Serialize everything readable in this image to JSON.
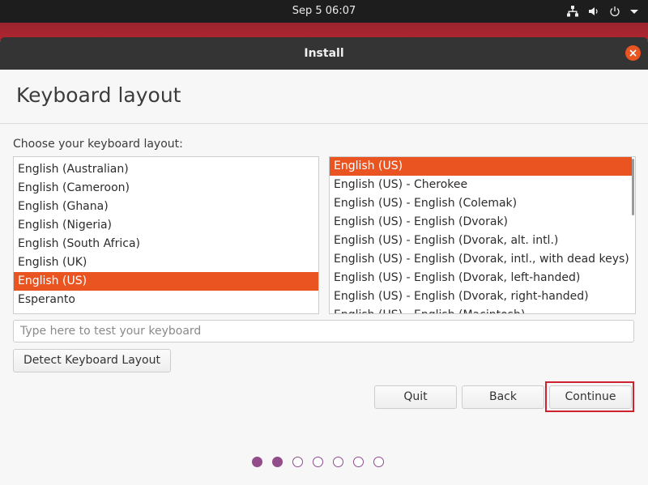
{
  "top_bar": {
    "clock": "Sep 5  06:07",
    "tray_icons": [
      "network-icon",
      "volume-icon",
      "power-icon",
      "menu-down-icon"
    ]
  },
  "window": {
    "title": "Install",
    "close_icon": "close-icon"
  },
  "page": {
    "heading": "Keyboard layout",
    "prompt": "Choose your keyboard layout:"
  },
  "layouts": {
    "items": [
      "English (Australian)",
      "English (Cameroon)",
      "English (Ghana)",
      "English (Nigeria)",
      "English (South Africa)",
      "English (UK)",
      "English (US)",
      "Esperanto"
    ],
    "selected": "English (US)"
  },
  "variants": {
    "items": [
      "English (US)",
      "English (US) - Cherokee",
      "English (US) - English (Colemak)",
      "English (US) - English (Dvorak)",
      "English (US) - English (Dvorak, alt. intl.)",
      "English (US) - English (Dvorak, intl., with dead keys)",
      "English (US) - English (Dvorak, left-handed)",
      "English (US) - English (Dvorak, right-handed)",
      "English (US) - English (Macintosh)"
    ],
    "selected": "English (US)"
  },
  "test_input": {
    "value": "",
    "placeholder": "Type here to test your keyboard"
  },
  "buttons": {
    "detect": "Detect Keyboard Layout",
    "quit": "Quit",
    "back": "Back",
    "continue": "Continue"
  },
  "progress": {
    "total_steps": 7,
    "completed_steps": 2
  },
  "colors": {
    "accent": "#e95420",
    "progress": "#924d8b",
    "highlight": "#d0222e"
  }
}
